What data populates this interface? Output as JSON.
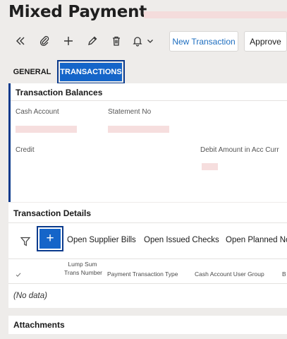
{
  "page": {
    "title": "Mixed Payment"
  },
  "toolbar": {
    "new_transaction_label": "New Transaction",
    "approve_label": "Approve"
  },
  "tabs": [
    {
      "label": "GENERAL",
      "active": false
    },
    {
      "label": "TRANSACTIONS",
      "active": true
    }
  ],
  "balances": {
    "title": "Transaction Balances",
    "cash_account_label": "Cash Account",
    "statement_no_label": "Statement No",
    "credit_label": "Credit",
    "debit_label": "Debit Amount in Acc Curr"
  },
  "details": {
    "title": "Transaction Details",
    "add_icon": "plus-icon",
    "actions": [
      "Open Supplier Bills",
      "Open Issued Checks",
      "Open Planned No"
    ],
    "columns": [
      {
        "line1": "Lump Sum",
        "line2": "Trans Number"
      },
      {
        "line1": "",
        "line2": "Payment Transaction Type"
      },
      {
        "line1": "",
        "line2": "Cash Account User Group"
      }
    ],
    "empty_text": "(No data)"
  },
  "attachments": {
    "title": "Attachments"
  },
  "colors": {
    "accent": "#1565c9",
    "focus_border": "#0a3a8c",
    "link": "#1c6dbf",
    "redaction": "#f6dede"
  }
}
